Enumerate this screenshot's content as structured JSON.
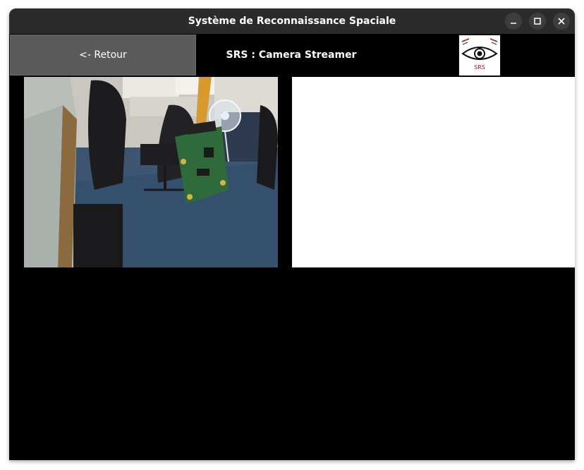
{
  "window": {
    "title": "Système de Reconnaissance Spaciale"
  },
  "toolbar": {
    "back_label": "<- Retour",
    "heading": "SRS : Camera Streamer",
    "logo_text": "SRS"
  },
  "camera": {
    "scene": "Live camera view of a lab with a circuit board hanging from a ribbon cable"
  },
  "icons": {
    "minimize": "minimize-icon",
    "maximize": "maximize-icon",
    "close": "close-icon",
    "logo": "eye-logo-icon"
  },
  "colors": {
    "titlebar": "#2b2b2b",
    "background": "#000000",
    "button": "#5a5a5a",
    "result_panel": "#ffffff"
  }
}
